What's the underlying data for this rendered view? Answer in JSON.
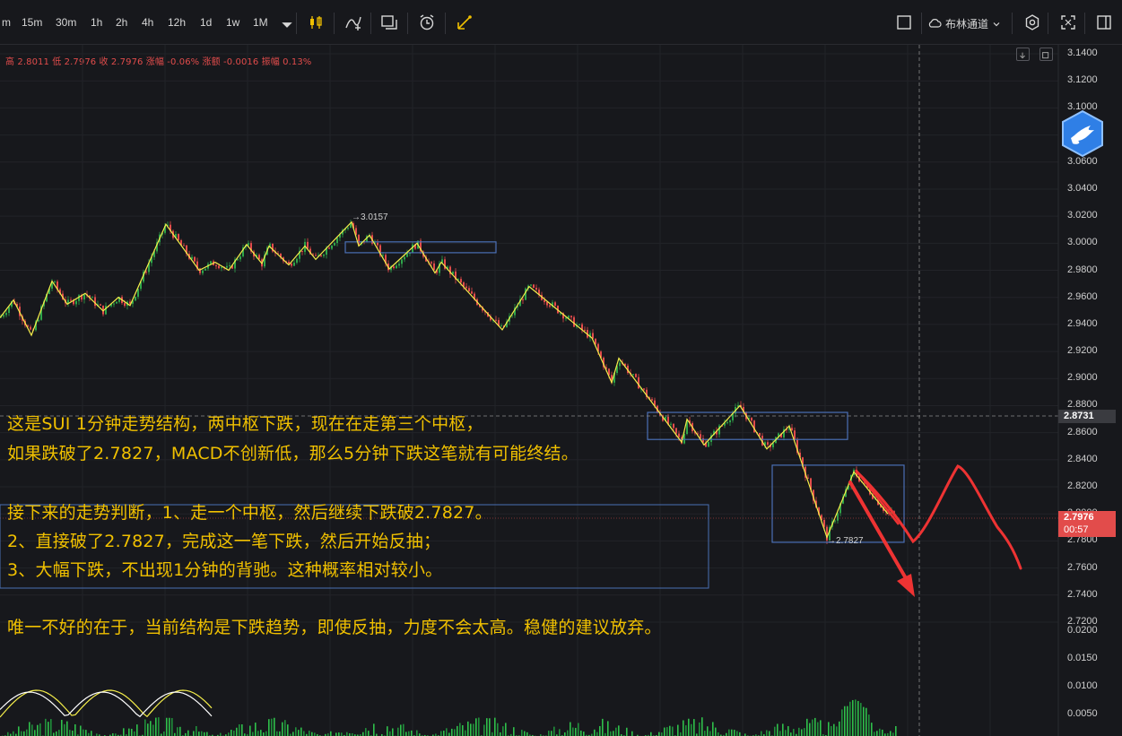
{
  "toolbar": {
    "timeframes": [
      "m",
      "15m",
      "30m",
      "1h",
      "2h",
      "4h",
      "12h",
      "1d",
      "1w",
      "1M"
    ],
    "channel_label": "布林通道"
  },
  "ohlc": {
    "high_label": "高",
    "high": "2.8011",
    "low_label": "低",
    "low": "2.7976",
    "close_label": "收",
    "close": "2.7976",
    "change_pct_label": "涨幅",
    "change_pct": "-0.06%",
    "change_amt_label": "涨额",
    "change_amt": "-0.0016",
    "amplitude_label": "振幅",
    "amplitude": "0.13%"
  },
  "price_axis": {
    "labels": [
      "3.1400",
      "3.1200",
      "3.1000",
      "3.0800",
      "3.0600",
      "3.0400",
      "3.0200",
      "3.0000",
      "2.9800",
      "2.9600",
      "2.9400",
      "2.9200",
      "2.9000",
      "2.8800",
      "2.8600",
      "2.8400",
      "2.8200",
      "2.8000",
      "2.7800",
      "2.7600",
      "2.7400",
      "2.7200"
    ],
    "macd_labels": [
      "0.0200",
      "0.0150",
      "0.0100",
      "0.0050"
    ],
    "crosshair_price": "2.8731",
    "current_price": "2.7976",
    "countdown": "00:57"
  },
  "markers": {
    "high": "→3.0157",
    "low": "→2.7827"
  },
  "annotation": {
    "line1": "这是SUI 1分钟走势结构，两中枢下跌，现在在走第三个中枢，",
    "line2": "如果跌破了2.7827，MACD不创新低，那么5分钟下跌这笔就有可能终结。",
    "line3": "接下来的走势判断，1、走一个中枢，然后继续下跌破2.7827。",
    "line4": "2、直接破了2.7827，完成这一笔下跌，然后开始反抽；",
    "line5": "3、大幅下跌，不出现1分钟的背驰。这种概率相对较小。",
    "line6": "唯一不好的在于，当前结构是下跌趋势，即使反抽，力度不会太高。稳健的建议放弃。"
  },
  "colors": {
    "background": "#17181c",
    "up": "#2fa54a",
    "down": "#e24c4b",
    "zigzag": "#f5ee4a",
    "annotation_text": "#f0c000",
    "zone_box": "#4a6fb5",
    "drawn_arrow": "#ee3333",
    "current_tag": "#e24c4b"
  },
  "chart_data": {
    "type": "candlestick",
    "zigzag_points": [
      [
        0,
        2.945
      ],
      [
        15,
        2.958
      ],
      [
        35,
        2.932
      ],
      [
        58,
        2.972
      ],
      [
        75,
        2.955
      ],
      [
        95,
        2.963
      ],
      [
        115,
        2.95
      ],
      [
        132,
        2.96
      ],
      [
        145,
        2.954
      ],
      [
        185,
        3.014
      ],
      [
        222,
        2.98
      ],
      [
        240,
        2.986
      ],
      [
        255,
        2.98
      ],
      [
        275,
        2.999
      ],
      [
        292,
        2.985
      ],
      [
        300,
        2.998
      ],
      [
        322,
        2.984
      ],
      [
        340,
        2.998
      ],
      [
        352,
        2.988
      ],
      [
        392,
        3.0157
      ],
      [
        400,
        2.998
      ],
      [
        412,
        3.006
      ],
      [
        434,
        2.981
      ],
      [
        465,
        3.0
      ],
      [
        485,
        2.978
      ],
      [
        492,
        2.986
      ],
      [
        560,
        2.936
      ],
      [
        590,
        2.968
      ],
      [
        660,
        2.93
      ],
      [
        682,
        2.897
      ],
      [
        690,
        2.915
      ],
      [
        760,
        2.853
      ],
      [
        766,
        2.87
      ],
      [
        785,
        2.851
      ],
      [
        825,
        2.88
      ],
      [
        855,
        2.848
      ],
      [
        880,
        2.865
      ],
      [
        922,
        2.7827
      ],
      [
        952,
        2.831
      ],
      [
        990,
        2.8
      ]
    ],
    "zone_boxes": [
      {
        "left_index": 385,
        "right_index": 553,
        "top": 3.001,
        "bottom": 2.993
      },
      {
        "left_index": 722,
        "right_index": 945,
        "top": 2.875,
        "bottom": 2.855
      },
      {
        "left_index": 861,
        "right_index": 1008,
        "top": 2.836,
        "bottom": 2.779
      }
    ],
    "high_marker": 3.0157,
    "low_marker": 2.7827,
    "current_price": 2.7976,
    "crosshair_price": 2.8731,
    "ylim": [
      2.72,
      3.145
    ]
  }
}
